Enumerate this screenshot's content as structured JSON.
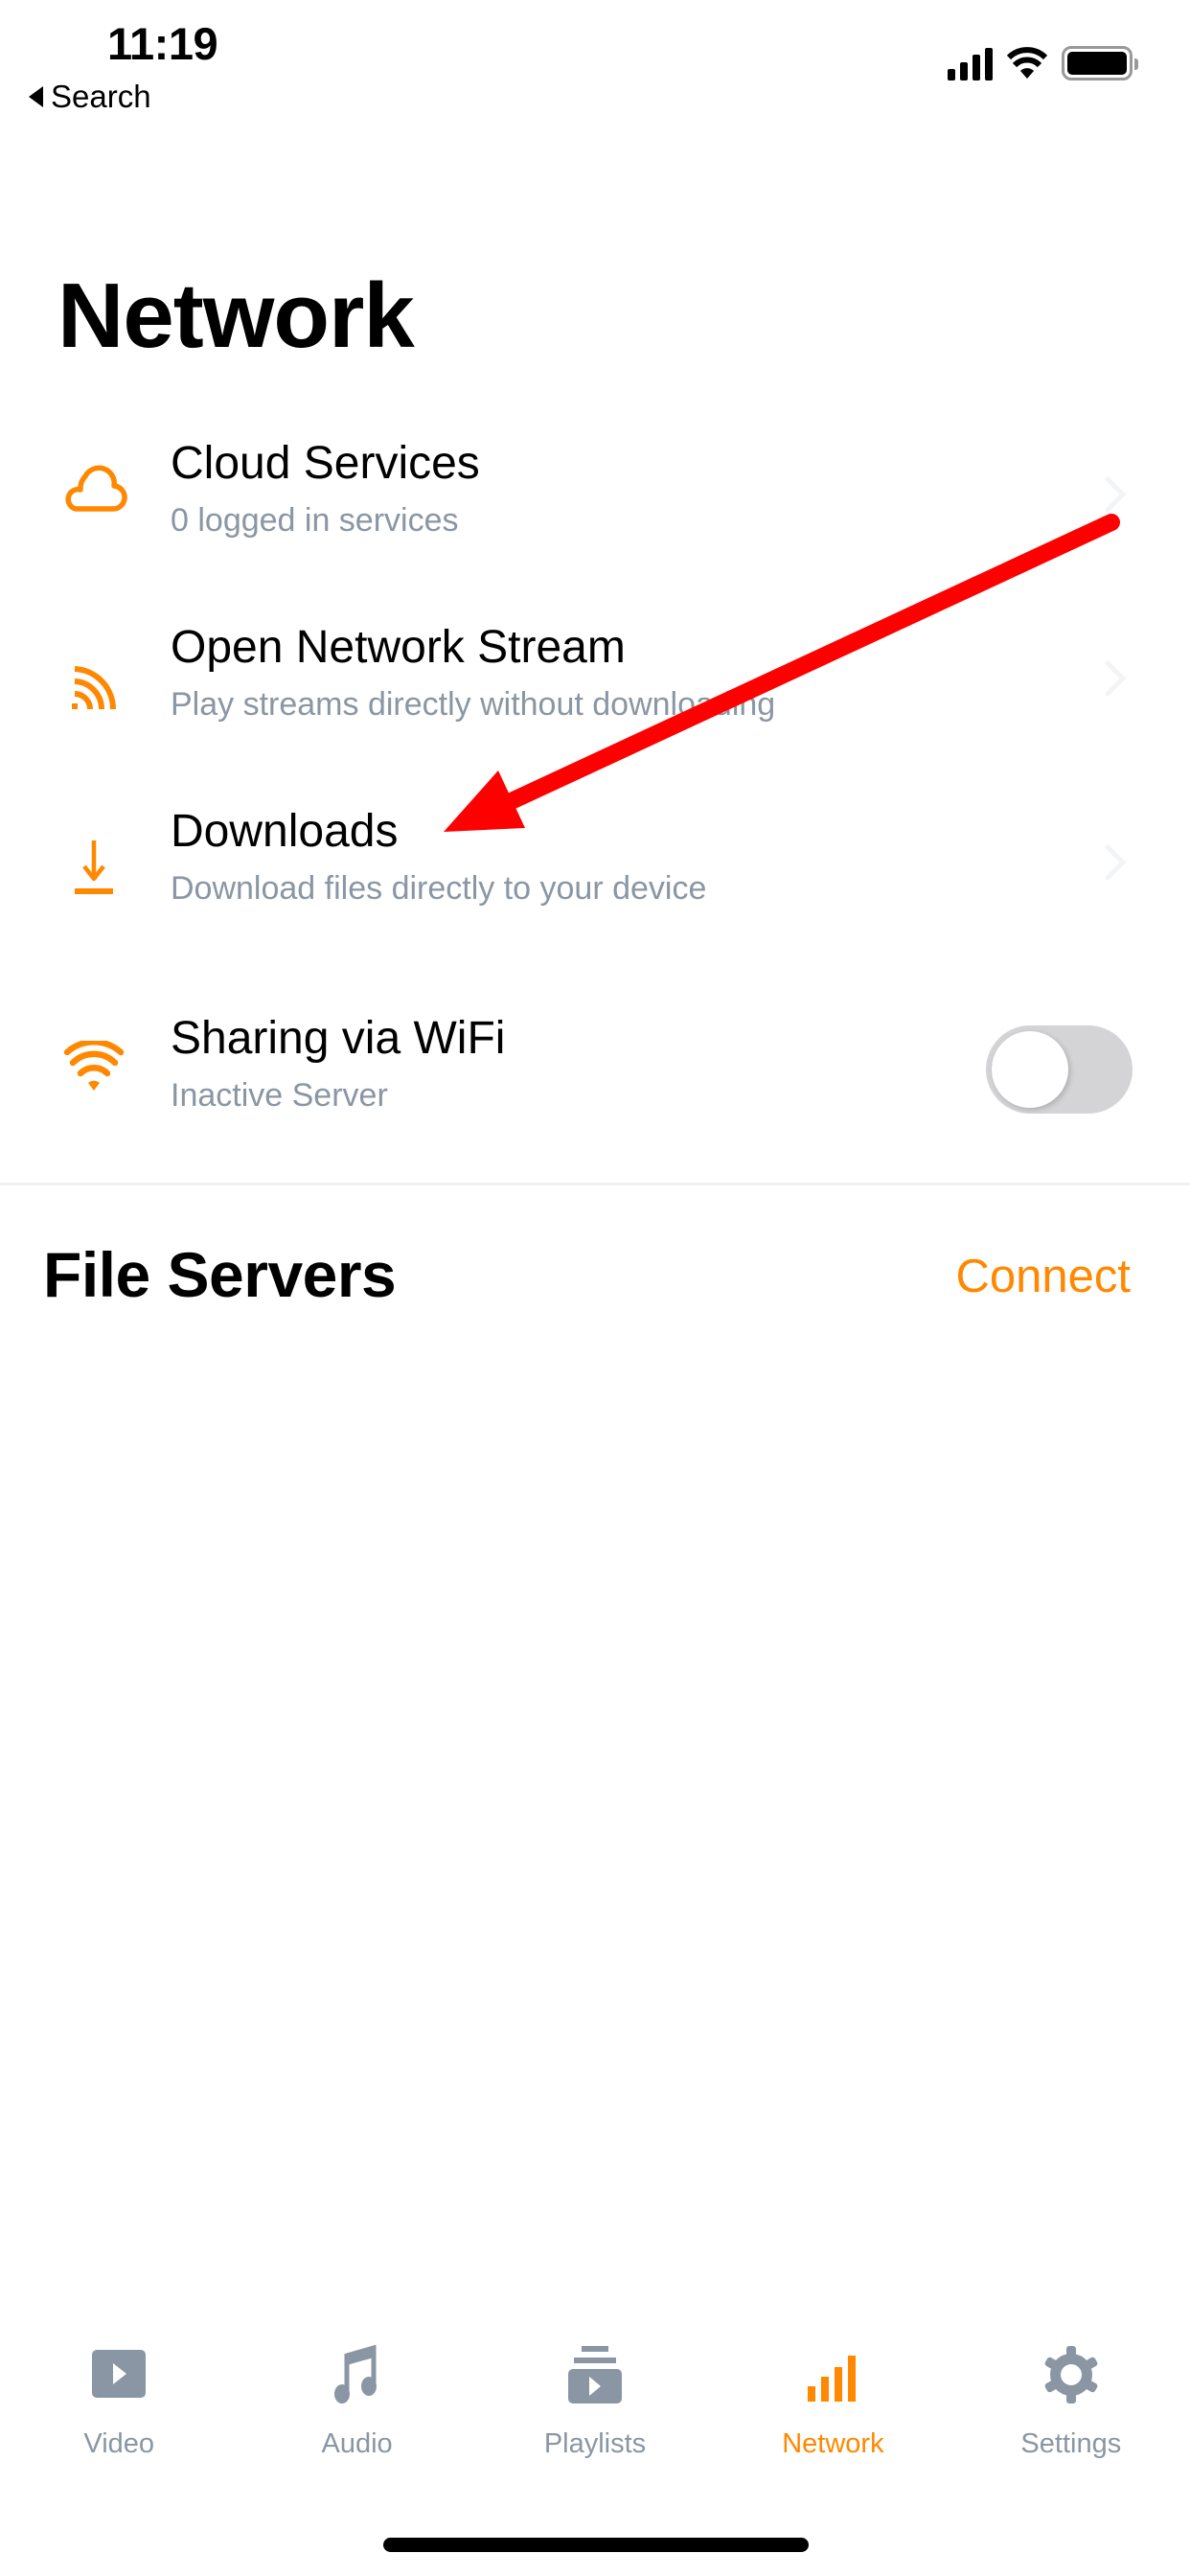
{
  "status_bar": {
    "time": "11:19",
    "back_label": "Search",
    "signal_bars": 4,
    "battery_level": 1.0
  },
  "page": {
    "title": "Network"
  },
  "items": [
    {
      "icon": "cloud-icon",
      "title": "Cloud Services",
      "subtitle": "0 logged in services",
      "has_chevron": true
    },
    {
      "icon": "stream-icon",
      "title": "Open Network Stream",
      "subtitle": "Play streams directly without downloading",
      "has_chevron": true
    },
    {
      "icon": "download-icon",
      "title": "Downloads",
      "subtitle": "Download files directly to your device",
      "has_chevron": true
    },
    {
      "icon": "wifi-icon",
      "title": "Sharing via WiFi",
      "subtitle": "Inactive Server",
      "toggle_on": false
    }
  ],
  "file_servers": {
    "title": "File Servers",
    "connect_label": "Connect"
  },
  "tabbar": {
    "tabs": [
      {
        "label": "Video",
        "icon": "video-icon",
        "active": false
      },
      {
        "label": "Audio",
        "icon": "music-note-icon",
        "active": false
      },
      {
        "label": "Playlists",
        "icon": "playlist-icon",
        "active": false
      },
      {
        "label": "Network",
        "icon": "network-bars-icon",
        "active": true
      },
      {
        "label": "Settings",
        "icon": "gear-icon",
        "active": false
      }
    ]
  },
  "colors": {
    "accent": "#ff8800",
    "inactive": "#8a96a3",
    "annotation_arrow": "#ff0000",
    "toggle_off": "#d4d4d6"
  },
  "annotation": {
    "type": "arrow",
    "points_to": "Downloads"
  }
}
